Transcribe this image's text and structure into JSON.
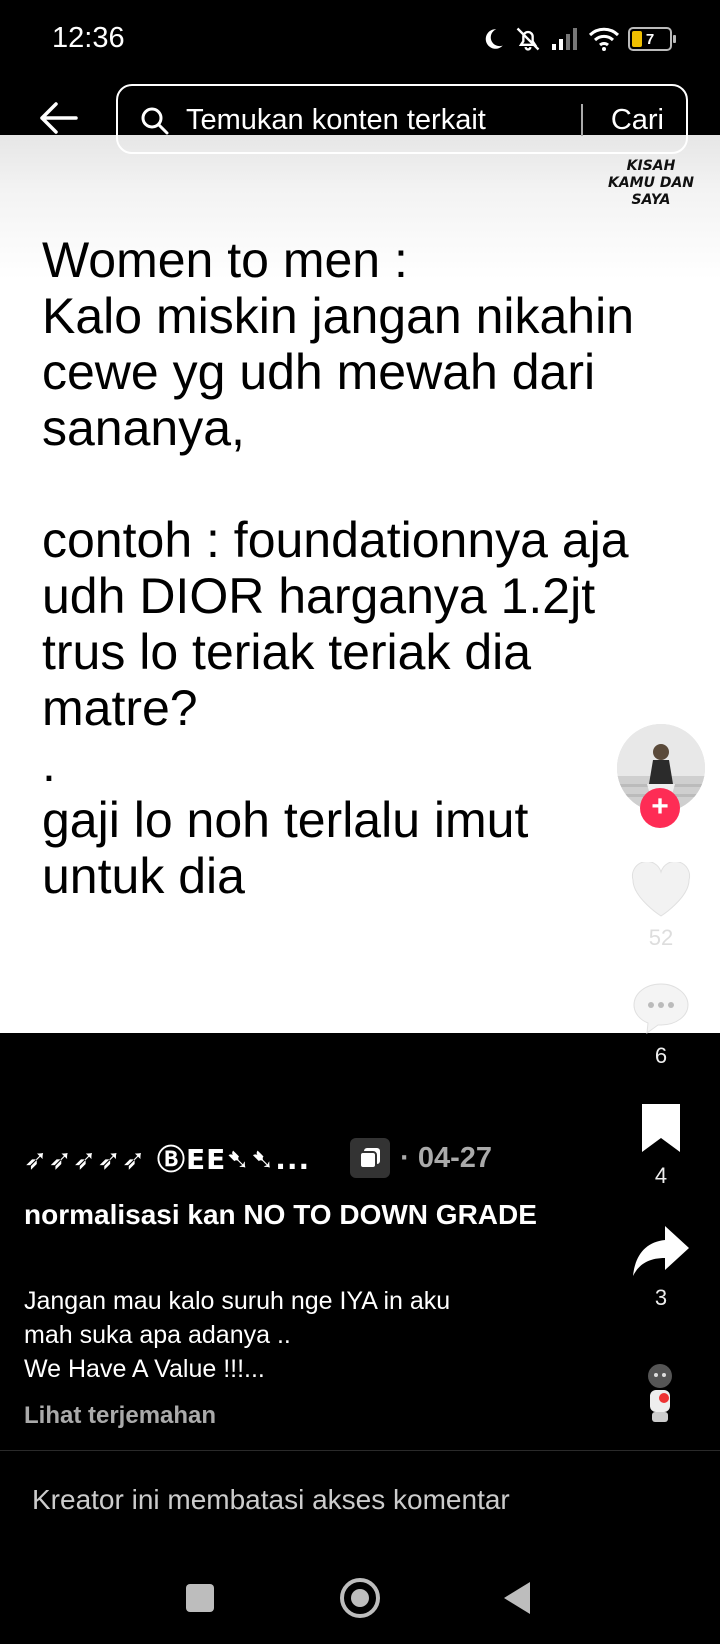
{
  "status_bar": {
    "time": "12:36",
    "battery_level": "7"
  },
  "search": {
    "placeholder": "Temukan konten terkait",
    "submit_label": "Cari"
  },
  "watermark": {
    "line1": "KISAH",
    "line2": "KAMU DAN",
    "line3": "SAYA"
  },
  "post_text": {
    "line1": "Women to men :",
    "line2": "Kalo miskin jangan nikahin",
    "line3": "cewe yg udh mewah dari",
    "line4": "sananya,",
    "line5": "contoh : foundationnya aja",
    "line6": "udh DIOR harganya 1.2jt",
    "line7": "trus lo teriak teriak dia",
    "line8": "matre?",
    "line9": ".",
    "line10": "gaji lo noh terlalu imut",
    "line11": "untuk dia"
  },
  "rail": {
    "follow_label": "+",
    "like_count": "52",
    "comment_count": "6",
    "save_count": "4",
    "share_count": "3"
  },
  "creator": {
    "name": "➶➶➶➶➶ ⒷEE➷➷...",
    "date": "· 04-27"
  },
  "caption": {
    "title": "normalisasi kan NO TO DOWN GRADE",
    "body_line1": "Jangan mau kalo suruh nge IYA in aku",
    "body_line2": "mah suka apa adanya ..",
    "body_line3": "We Have A Value !!!...",
    "translate": "Lihat terjemahan"
  },
  "comments": {
    "restricted_notice": "Kreator ini membatasi akses komentar"
  },
  "colors": {
    "accent": "#fe2c55",
    "background": "#000000",
    "video_bg": "#ffffff"
  }
}
